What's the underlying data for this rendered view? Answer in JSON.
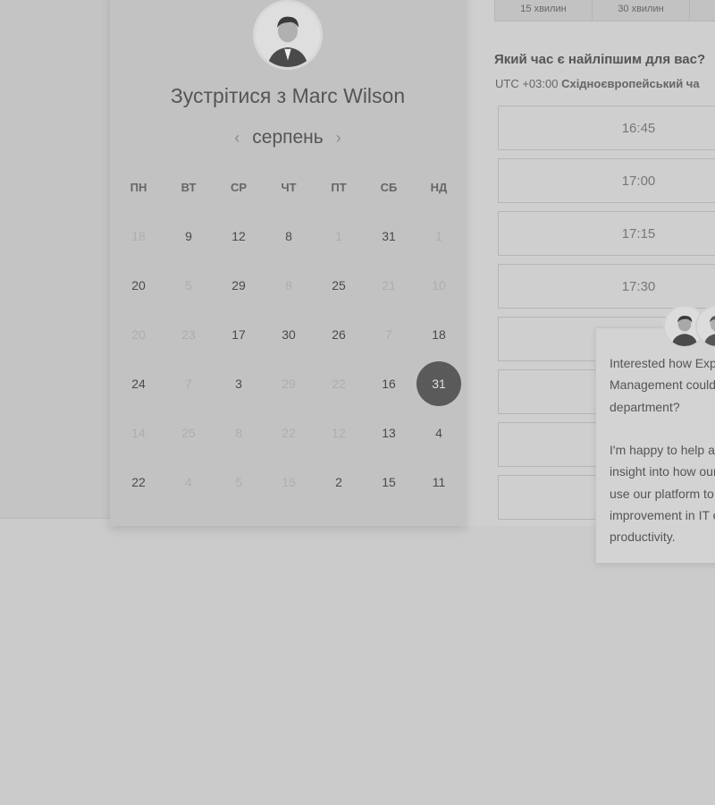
{
  "header": {
    "title_prefix": "Зустрітися з",
    "host_name": "Marc Wilson",
    "avatar_icon": "person-avatar-icon"
  },
  "calendar": {
    "month": "серпень",
    "prev_icon": "chevron-left-icon",
    "next_icon": "chevron-right-icon",
    "weekdays": [
      "ПН",
      "ВТ",
      "СР",
      "ЧТ",
      "ПТ",
      "СБ",
      "НД"
    ],
    "days": [
      {
        "label": "18",
        "muted": true
      },
      {
        "label": "9",
        "muted": false
      },
      {
        "label": "12",
        "muted": false
      },
      {
        "label": "8",
        "muted": false
      },
      {
        "label": "1",
        "muted": true
      },
      {
        "label": "31",
        "muted": false
      },
      {
        "label": "1",
        "muted": true
      },
      {
        "label": "20",
        "muted": false
      },
      {
        "label": "5",
        "muted": true
      },
      {
        "label": "29",
        "muted": false
      },
      {
        "label": "8",
        "muted": true
      },
      {
        "label": "25",
        "muted": false
      },
      {
        "label": "21",
        "muted": true
      },
      {
        "label": "10",
        "muted": true
      },
      {
        "label": "20",
        "muted": true
      },
      {
        "label": "23",
        "muted": true
      },
      {
        "label": "17",
        "muted": false
      },
      {
        "label": "30",
        "muted": false
      },
      {
        "label": "26",
        "muted": false
      },
      {
        "label": "7",
        "muted": true
      },
      {
        "label": "18",
        "muted": false
      },
      {
        "label": "24",
        "muted": false
      },
      {
        "label": "7",
        "muted": true
      },
      {
        "label": "3",
        "muted": false
      },
      {
        "label": "29",
        "muted": true
      },
      {
        "label": "22",
        "muted": true
      },
      {
        "label": "16",
        "muted": false
      },
      {
        "label": "31",
        "muted": false,
        "selected": true
      },
      {
        "label": "14",
        "muted": true
      },
      {
        "label": "25",
        "muted": true
      },
      {
        "label": "8",
        "muted": true
      },
      {
        "label": "22",
        "muted": true
      },
      {
        "label": "12",
        "muted": true
      },
      {
        "label": "13",
        "muted": false
      },
      {
        "label": "4",
        "muted": false
      },
      {
        "label": "22",
        "muted": false
      },
      {
        "label": "4",
        "muted": true
      },
      {
        "label": "5",
        "muted": true
      },
      {
        "label": "15",
        "muted": true
      },
      {
        "label": "2",
        "muted": false
      },
      {
        "label": "15",
        "muted": false
      },
      {
        "label": "11",
        "muted": false
      }
    ]
  },
  "duration_tabs": [
    "15 хвилин",
    "30 хвилин"
  ],
  "time_question": "Який час є найліпшим для вас?",
  "timezone": {
    "offset": "UTC +03:00",
    "name": "Східноєвропейський ча"
  },
  "time_slots": [
    "16:45",
    "17:00",
    "17:15",
    "17:30",
    "",
    "",
    "",
    ""
  ],
  "chat": {
    "message": "Interested how Exp\nManagement could\ndepartment?\n\nI'm happy to help a\ninsight into how our\nuse our platform to\nimprovement in IT e\nproductivity.",
    "avatar_icons": [
      "agent-avatar-icon",
      "agent-avatar-icon"
    ]
  }
}
